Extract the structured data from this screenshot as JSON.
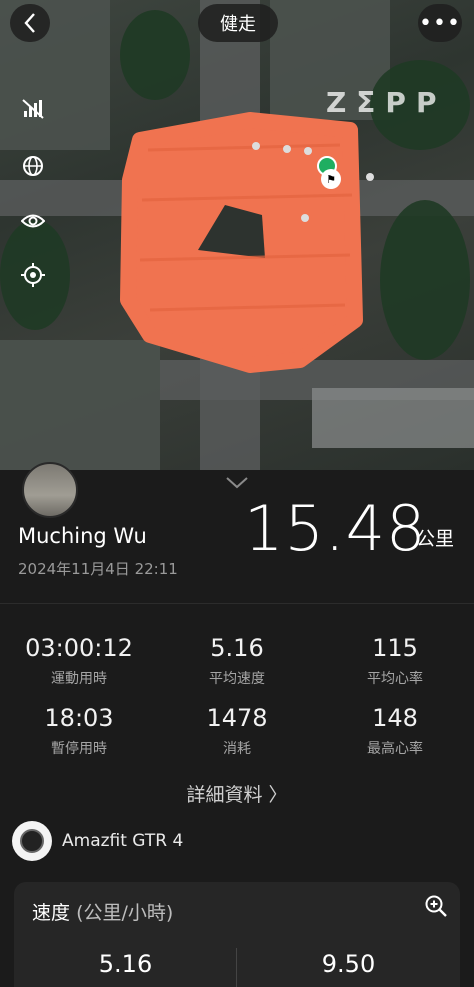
{
  "header": {
    "title": "健走",
    "brand": "ZΣPP"
  },
  "map_controls": {
    "icons": [
      "signal-off-icon",
      "globe-icon",
      "eye-icon",
      "locate-icon"
    ]
  },
  "user": {
    "name": "Muching Wu",
    "datetime": "2024年11月4日 22:11"
  },
  "summary": {
    "distance": "15.48",
    "unit": "公里"
  },
  "stats": [
    {
      "value": "03:00:12",
      "label": "運動用時"
    },
    {
      "value": "5.16",
      "label": "平均速度"
    },
    {
      "value": "115",
      "label": "平均心率"
    },
    {
      "value": "18:03",
      "label": "暫停用時"
    },
    {
      "value": "1478",
      "label": "消耗"
    },
    {
      "value": "148",
      "label": "最高心率"
    }
  ],
  "detail_link": "詳細資料 〉",
  "device": {
    "name": "Amazfit GTR 4"
  },
  "speed": {
    "title": "速度",
    "unit": "(公里/小時)",
    "avg": "5.16",
    "max": "9.50"
  },
  "colors": {
    "route": "#f07350",
    "background": "#1b1b1b"
  }
}
